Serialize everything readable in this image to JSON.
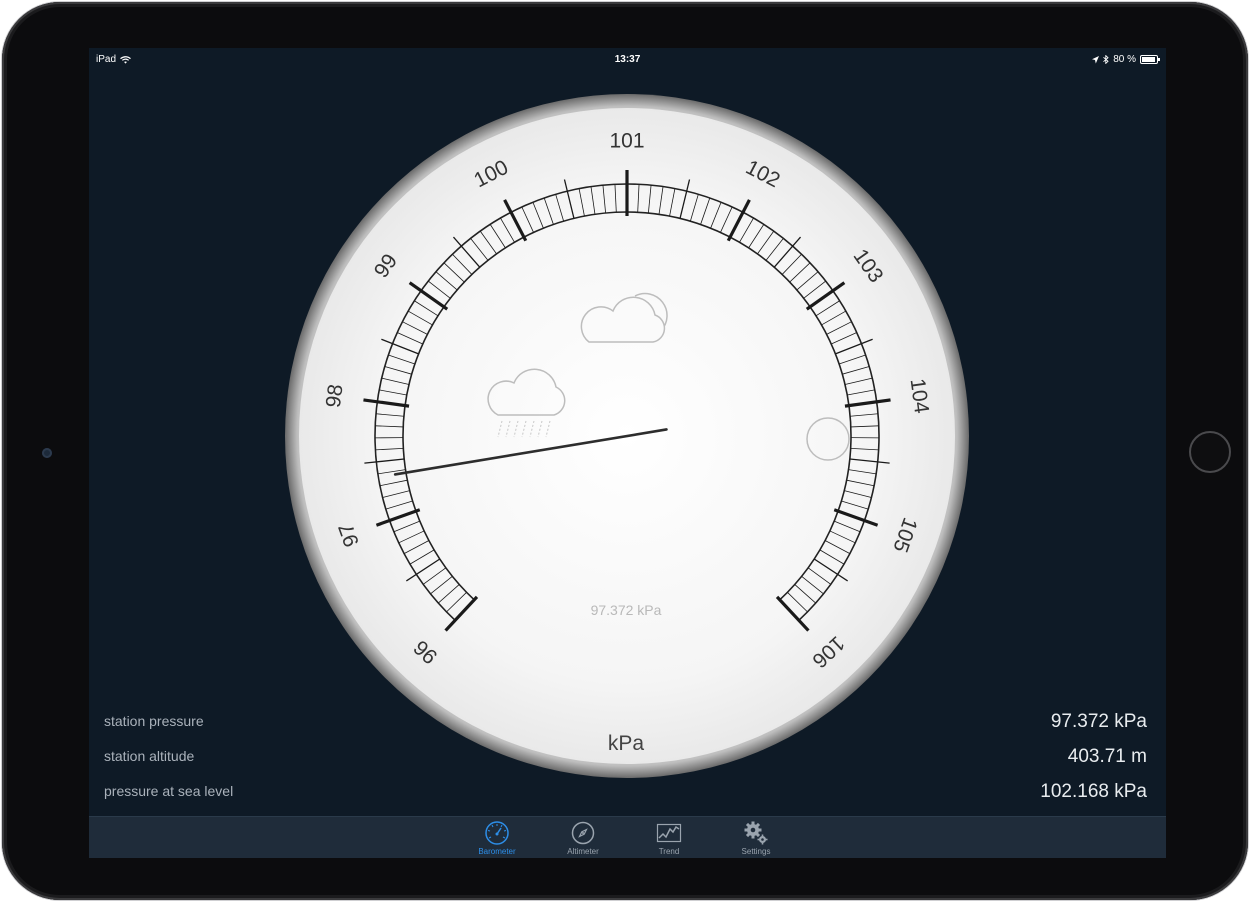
{
  "status_bar": {
    "device": "iPad",
    "time": "13:37",
    "battery": "80 %",
    "battery_fraction": 0.8
  },
  "gauge": {
    "scale_min": 96,
    "scale_max": 106,
    "labels": [
      "96",
      "97",
      "98",
      "99",
      "100",
      "101",
      "102",
      "103",
      "104",
      "105",
      "106"
    ],
    "unit": "kPa",
    "current_reading": "97.372 kPa",
    "needle_value": 97.372,
    "weather_icons": [
      "rain-cloud-icon",
      "cloudy-icon",
      "sunny-icon"
    ]
  },
  "readings": [
    {
      "label": "station pressure",
      "value": "97.372 kPa"
    },
    {
      "label": "station altitude",
      "value": "403.71 m"
    },
    {
      "label": "pressure at sea level",
      "value": "102.168 kPa"
    }
  ],
  "tabs": [
    {
      "label": "Barometer",
      "icon": "barometer-icon",
      "active": true
    },
    {
      "label": "Altimeter",
      "icon": "compass-icon",
      "active": false
    },
    {
      "label": "Trend",
      "icon": "trend-chart-icon",
      "active": false
    },
    {
      "label": "Settings",
      "icon": "gear-icon",
      "active": false
    }
  ],
  "colors": {
    "background": "#0e1a26",
    "tab_bar": "#1f2c3a",
    "accent": "#2d8ee8"
  }
}
